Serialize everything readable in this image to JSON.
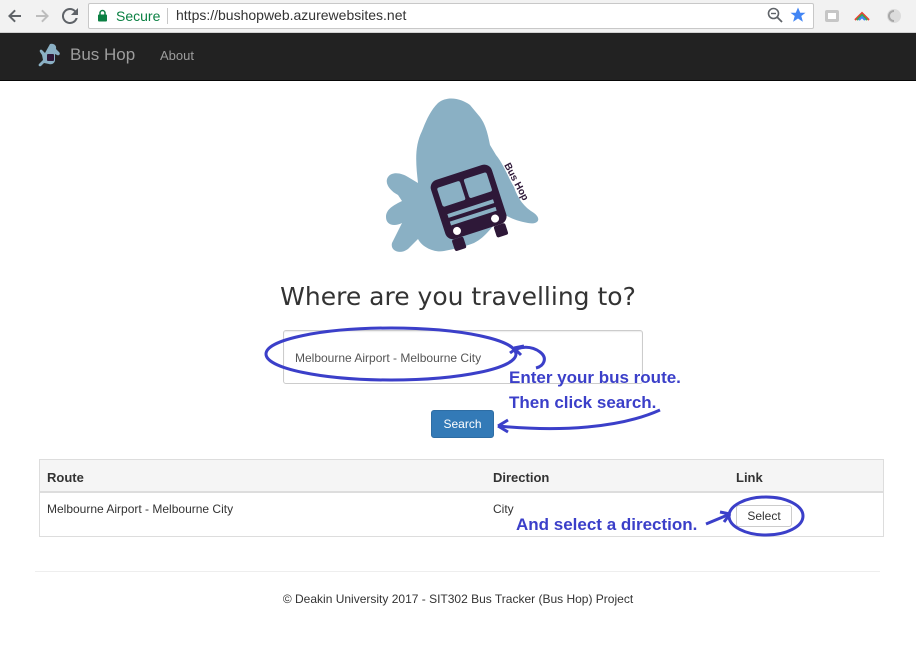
{
  "browser": {
    "secure_label": "Secure",
    "url": "https://bushopweb.azurewebsites.net"
  },
  "navbar": {
    "brand": "Bus Hop",
    "about": "About"
  },
  "logo": {
    "text": "Bus Hop",
    "hand_color": "#8ab0c4",
    "bus_color": "#2e1838"
  },
  "main": {
    "heading": "Where are you travelling to?",
    "search_value": "Melbourne Airport - Melbourne City",
    "search_button": "Search"
  },
  "table": {
    "headers": [
      "Route",
      "Direction",
      "Link"
    ],
    "rows": [
      {
        "route": "Melbourne Airport - Melbourne City",
        "direction": "City",
        "link": "Select"
      }
    ]
  },
  "footer": {
    "text": "© Deakin University 2017 - SIT302 Bus Tracker (Bus Hop) Project"
  },
  "annotations": {
    "line1": "Enter your bus route.",
    "line2": "Then click search.",
    "line3": "And select a direction.",
    "color": "#3b3fc9"
  },
  "colors": {
    "primary_button": "#337ab7",
    "navbar": "#222222"
  }
}
